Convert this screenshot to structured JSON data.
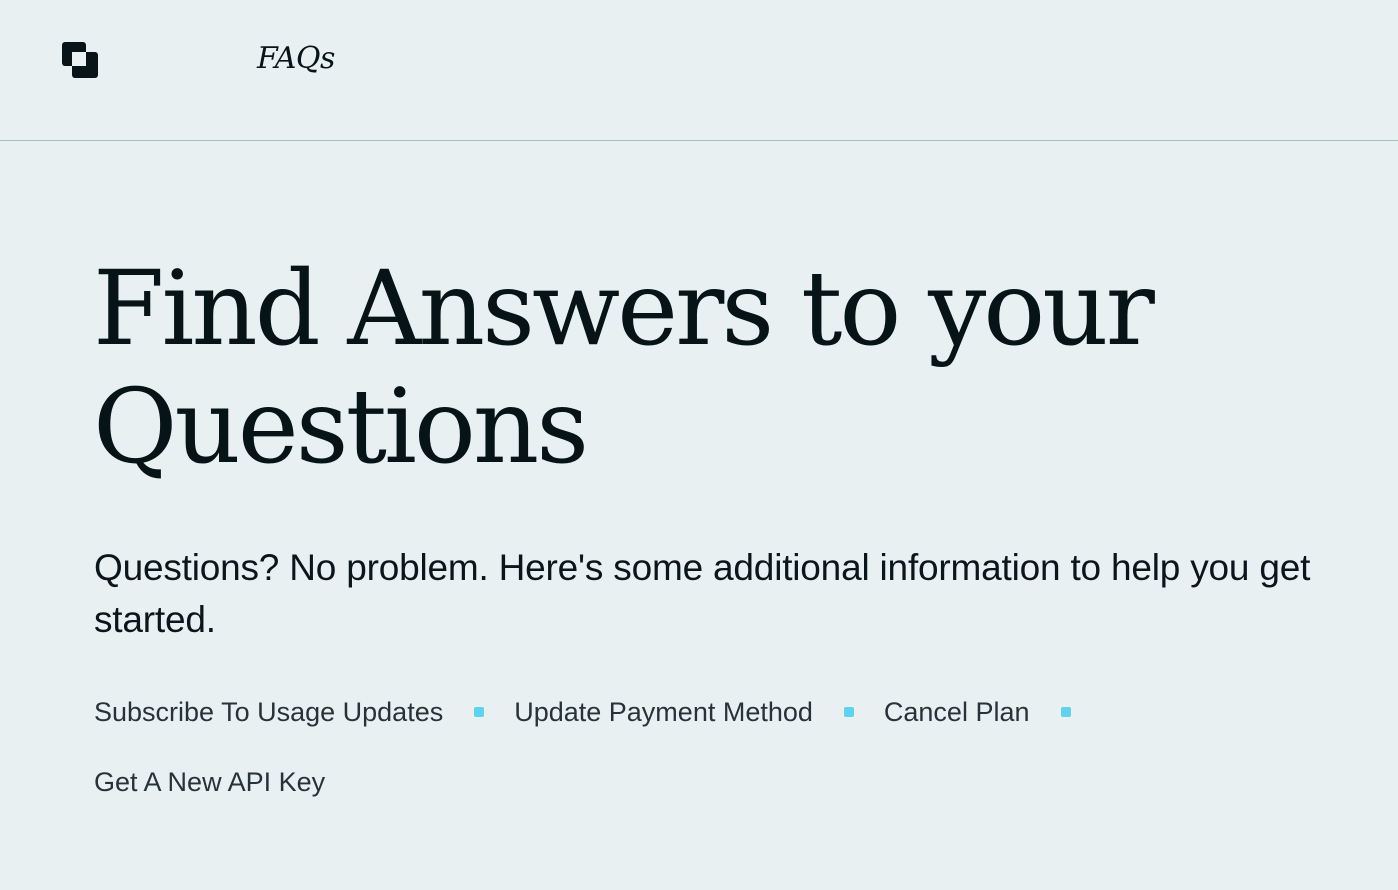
{
  "nav": {
    "logo_icon": "overlapping-squares-logo",
    "faqs_label": "FAQs"
  },
  "hero": {
    "title": "Find Answers to your Questions",
    "subtitle": "Questions? No problem. Here's some additional information to help you get started."
  },
  "quick_links": [
    {
      "label": "Subscribe To Usage Updates"
    },
    {
      "label": "Update Payment Method"
    },
    {
      "label": "Cancel Plan"
    },
    {
      "label": "Get A New API Key"
    }
  ],
  "colors": {
    "background": "#e9f0f2",
    "text": "#07141a",
    "divider": "#a9bfc3",
    "accent_dot": "#5dd3ee"
  }
}
